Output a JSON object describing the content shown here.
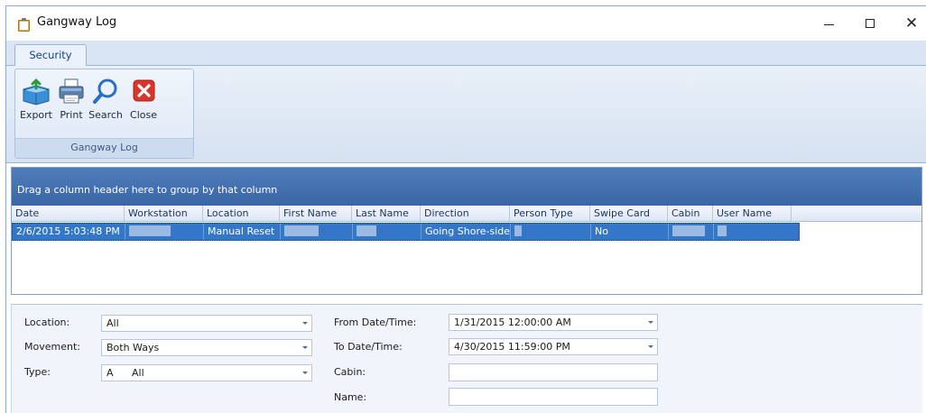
{
  "window": {
    "title": "Gangway Log",
    "controls": {
      "minimize": "—",
      "maximize": "☐",
      "close": "✕"
    }
  },
  "ribbon": {
    "tab": "Security",
    "group_caption": "Gangway Log",
    "buttons": {
      "export": "Export",
      "print": "Print",
      "search": "Search",
      "close": "Close"
    }
  },
  "grid": {
    "group_panel_text": "Drag a column header here to group by that column",
    "columns": [
      "Date",
      "Workstation",
      "Location",
      "First Name",
      "Last Name",
      "Direction",
      "Person Type",
      "Swipe Card",
      "Cabin",
      "User Name"
    ],
    "row": {
      "date": "2/6/2015 5:03:48 PM",
      "location": "Manual Reset",
      "direction": "Going Shore-side",
      "swipe_card": "No"
    }
  },
  "filters": {
    "location_label": "Location:",
    "location_value": "All",
    "movement_label": "Movement:",
    "movement_value": "Both Ways",
    "type_label": "Type:",
    "type_code": "A",
    "type_value": "All",
    "from_label": "From Date/Time:",
    "from_value": "1/31/2015 12:00:00 AM",
    "to_label": "To Date/Time:",
    "to_value": "4/30/2015 11:59:00 PM",
    "cabin_label": "Cabin:",
    "name_label": "Name:"
  },
  "colors": {
    "selection": "#3476c8",
    "group_panel": "#4a78b8",
    "ribbon_bg": "#dfe8f5",
    "close_icon": "#d9362b"
  }
}
